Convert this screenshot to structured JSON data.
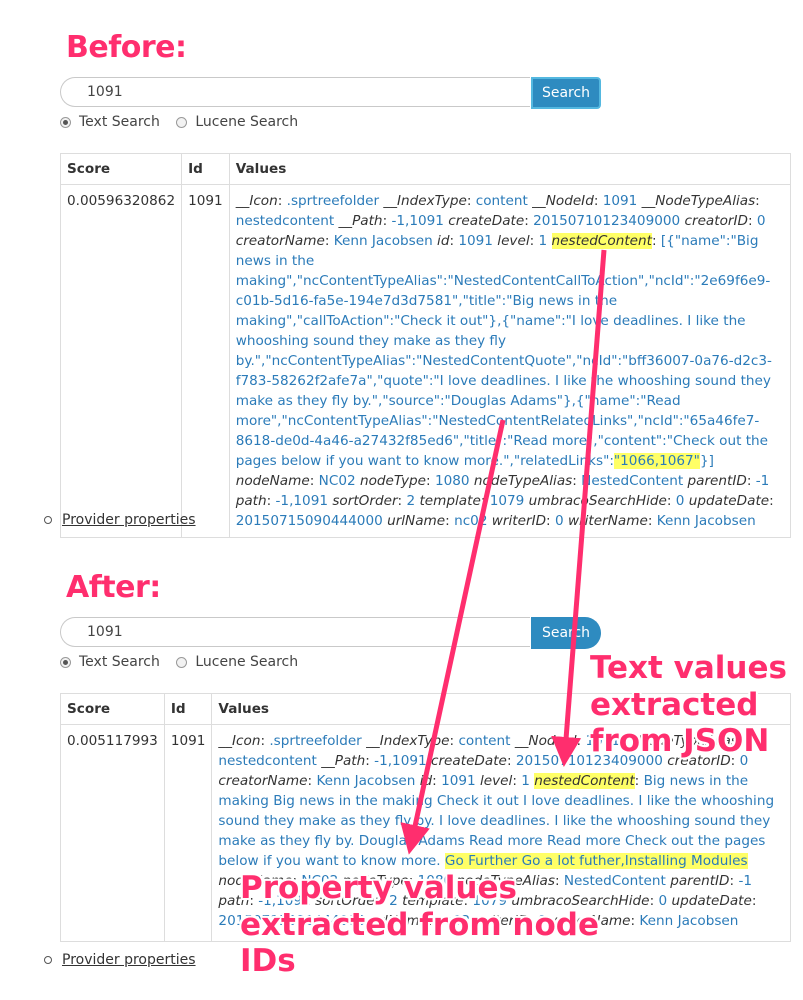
{
  "before": {
    "heading": "Before:",
    "search_value": "1091",
    "search_button": "Search",
    "radio_text": "Text Search",
    "radio_lucene": "Lucene Search",
    "headers": [
      "Score",
      "Id",
      "Values"
    ],
    "score": "0.00596320862",
    "id": "1091",
    "provider_link": "Provider properties"
  },
  "after": {
    "heading": "After:",
    "search_value": "1091",
    "search_button": "Search",
    "radio_text": "Text Search",
    "radio_lucene": "Lucene Search",
    "headers": [
      "Score",
      "Id",
      "Values"
    ],
    "score": "0.005117993",
    "id": "1091",
    "provider_link": "Provider properties"
  },
  "annotations": {
    "text_values": "Text values extracted from JSON",
    "property_values": "Property values extracted from node IDs"
  },
  "colors": {
    "annotation": "#ff2e6e",
    "link": "#2b7bb9",
    "highlight": "#ffff66",
    "button": "#2e8bc0"
  }
}
